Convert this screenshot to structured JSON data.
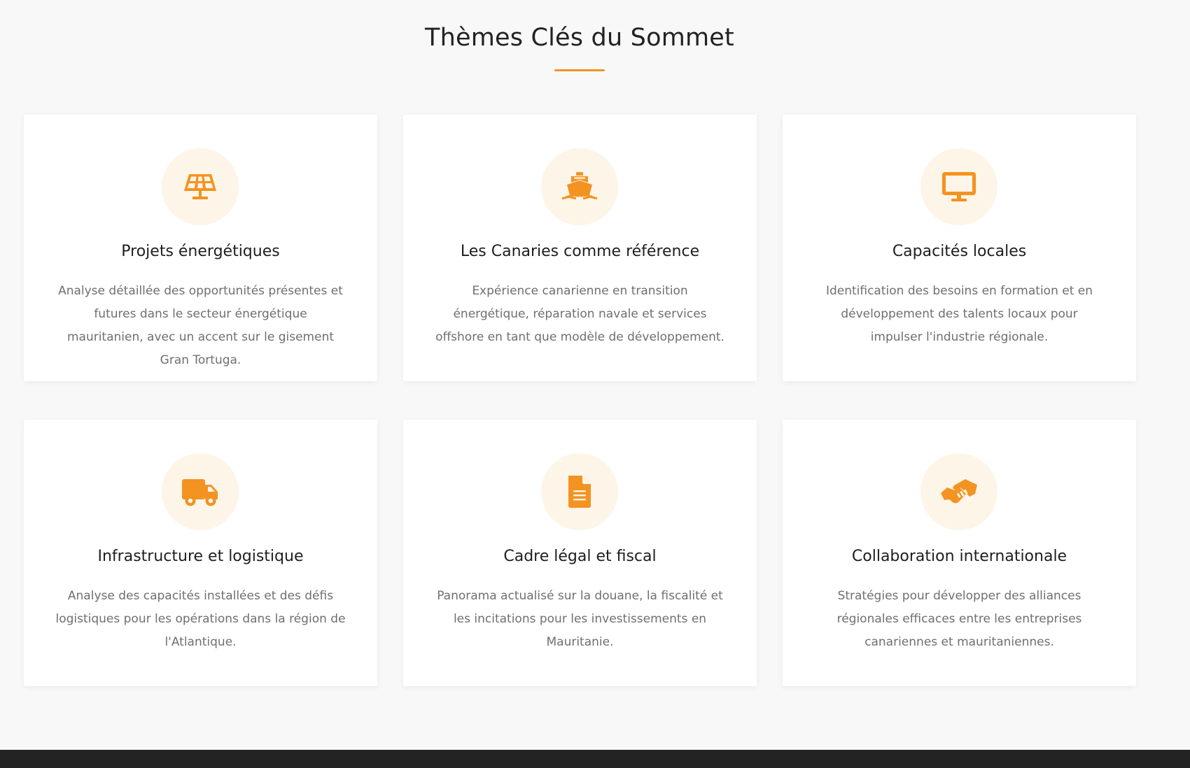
{
  "section": {
    "title": "Thèmes Clés du Sommet",
    "accent_color": "#f39322",
    "icon_bg_color": "#fdf5e7",
    "cards": [
      {
        "icon": "solar-panel-icon",
        "title": "Projets énergétiques",
        "text": "Analyse détaillée des opportunités présentes et futures dans le secteur énergétique mauritanien, avec un accent sur le gisement Gran Tortuga."
      },
      {
        "icon": "ship-icon",
        "title": "Les Canaries comme référence",
        "text": "Expérience canarienne en transition énergétique, réparation navale et services offshore en tant que modèle de développement."
      },
      {
        "icon": "monitor-icon",
        "title": "Capacités locales",
        "text": "Identification des besoins en formation et en développement des talents locaux pour impulser l'industrie régionale."
      },
      {
        "icon": "truck-icon",
        "title": "Infrastructure et logistique",
        "text": "Analyse des capacités installées et des défis logistiques pour les opérations dans la région de l'Atlantique."
      },
      {
        "icon": "document-icon",
        "title": "Cadre légal et fiscal",
        "text": "Panorama actualisé sur la douane, la fiscalité et les incitations pour les investissements en Mauritanie."
      },
      {
        "icon": "handshake-icon",
        "title": "Collaboration internationale",
        "text": "Stratégies pour développer des alliances régionales efficaces entre les entreprises canariennes et mauritaniennes."
      }
    ]
  },
  "footer": {
    "background_color": "#232323"
  }
}
